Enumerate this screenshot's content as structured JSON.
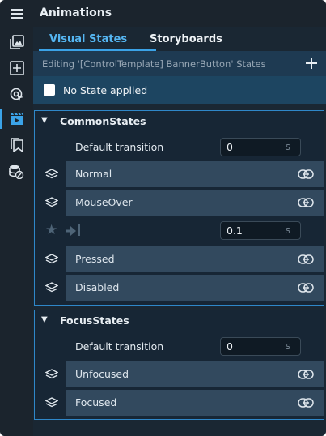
{
  "window": {
    "title": "Animations"
  },
  "toolbar": {
    "icons": [
      "image-gallery-icon",
      "add-square-icon",
      "target-pointer-icon",
      "film-clapper-icon",
      "bookmarks-icon",
      "database-link-icon"
    ],
    "active_index": 3
  },
  "tabs": [
    {
      "label": "Visual States",
      "active": true
    },
    {
      "label": "Storyboards",
      "active": false
    }
  ],
  "editing": {
    "text": "Editing '[ControlTemplate] BannerButton' States",
    "add_label": "+"
  },
  "no_state": {
    "label": "No State applied",
    "checked": false
  },
  "groups": [
    {
      "title": "CommonStates",
      "default_transition": {
        "label": "Default transition",
        "value": "0",
        "unit": "s"
      },
      "states": [
        {
          "name": "Normal"
        },
        {
          "name": "MouseOver"
        },
        {
          "name": "Pressed"
        },
        {
          "name": "Disabled"
        }
      ],
      "transition": {
        "value": "0.1",
        "unit": "s"
      }
    },
    {
      "title": "FocusStates",
      "default_transition": {
        "label": "Default transition",
        "value": "0",
        "unit": "s"
      },
      "states": [
        {
          "name": "Unfocused"
        },
        {
          "name": "Focused"
        }
      ]
    }
  ],
  "colors": {
    "accent": "#3ba3e8",
    "panel": "#1a2733",
    "state_bar": "#32495e",
    "group_border": "#2f87c8"
  }
}
